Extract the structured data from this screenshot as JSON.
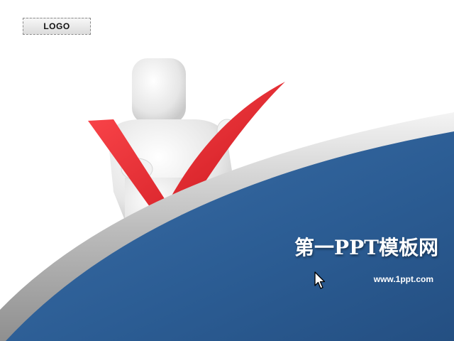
{
  "logo": {
    "label": "LOGO"
  },
  "slide": {
    "title": "第一PPT模板网",
    "url": "www.1ppt.com"
  },
  "colors": {
    "wave_blue": "#2d5f95",
    "silver_band": "#c8c8c8",
    "checkmark_red": "#e0232b",
    "background": "#ffffff"
  },
  "illustration": {
    "figure_icon": "person-holding-checkmark-icon",
    "cursor_icon": "mouse-pointer-icon"
  }
}
